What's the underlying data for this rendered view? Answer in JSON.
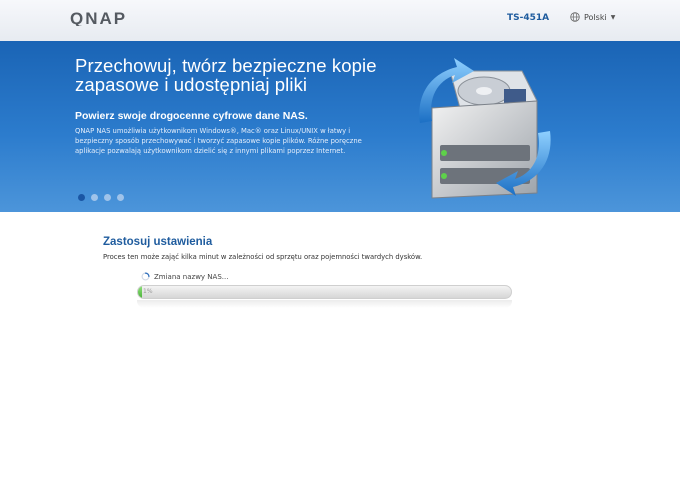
{
  "header": {
    "logo": "QNAP",
    "model": "TS-451A",
    "language": "Polski",
    "globe_icon": "globe-icon",
    "caret_icon": "chevron-down-icon"
  },
  "banner": {
    "title": "Przechowuj, twórz bezpieczne kopie zapasowe i udostępniaj pliki",
    "subtitle": "Powierz swoje drogocenne cyfrowe dane NAS.",
    "description": "QNAP NAS umożliwia użytkownikom Windows®, Mac® oraz Linux/UNIX w łatwy i bezpieczny sposób przechowywać i tworzyć zapasowe kopie plików. Różne poręczne aplikacje pozwalają użytkownikom dzielić się z innymi plikami poprzez Internet.",
    "slides": [
      {
        "active": true
      },
      {
        "active": false
      },
      {
        "active": false
      },
      {
        "active": false
      }
    ],
    "illustration_icon": "hard-drive-sync-icon",
    "colors": {
      "banner_top": "#1a64b5",
      "banner_bottom": "#4c95da"
    }
  },
  "main": {
    "title": "Zastosuj ustawienia",
    "description": "Proces ten może zająć kilka minut w zależności od sprzętu oraz pojemności twardych dysków.",
    "status": "Zmiana nazwy NAS...",
    "progress_label": "1%",
    "progress_value": 0.01,
    "colors": {
      "accent": "#1f5c9e",
      "progress": "#4cb33a"
    }
  }
}
